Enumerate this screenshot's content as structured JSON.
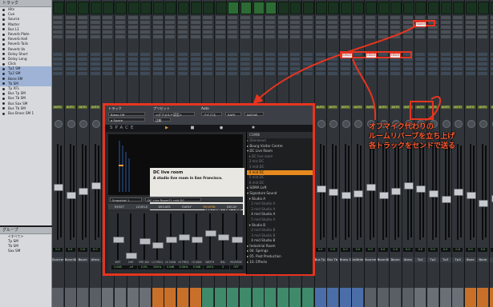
{
  "tracks_panel": {
    "title": "トラック",
    "items": [
      {
        "label": "Hits"
      },
      {
        "label": "Cue"
      },
      {
        "label": "Source"
      },
      {
        "label": "Master"
      },
      {
        "label": "Bus L1"
      },
      {
        "label": "Reverb Plate"
      },
      {
        "label": "Reverb Hall"
      },
      {
        "label": "Reverb Tails"
      },
      {
        "label": "Reverb Vo"
      },
      {
        "label": "Delay Short"
      },
      {
        "label": "Delay Long"
      },
      {
        "label": "Click"
      },
      {
        "label": "Tp1 SM",
        "selected": true
      },
      {
        "label": "Tp2 SM",
        "selected": true
      },
      {
        "label": "Bone SM",
        "selected": true
      },
      {
        "label": "Tb SM",
        "selected": true
      },
      {
        "label": "Tp XFL"
      },
      {
        "label": "Bus Tp SM"
      },
      {
        "label": "Bus Tb SM"
      },
      {
        "label": "Bus Sax SM"
      },
      {
        "label": "Bus Tb SM"
      },
      {
        "label": "Bus Brass SM 1"
      }
    ]
  },
  "groups_panel": {
    "title": "グループ",
    "items": [
      {
        "label": "<すべて>"
      },
      {
        "label": "Tp SM"
      },
      {
        "label": "Tb SM"
      },
      {
        "label": "Sax SM"
      }
    ]
  },
  "strip_labels": [
    "Sources",
    "Bourn$MX",
    "Bourn",
    "Atmo",
    "Tp1",
    "Tp2",
    "Tp3",
    "Tp4",
    "Bone",
    "Bone",
    "Tb",
    "Tb",
    "Sax",
    "Sax",
    "Sax",
    "Sax",
    "Sax",
    "Sax",
    "Sax",
    "Sax",
    "Sax",
    "Bus Tp SM",
    "Bus Tb SM",
    "Brass Off",
    "AnBrdmL1"
  ],
  "strip_inserts": [
    "Space",
    "Space",
    "Space",
    "BCAB.LEAT",
    "Half Fury D",
    "H Ceeks",
    "Snooker",
    "SXPRTCX",
    "1000",
    "Space",
    "Space",
    "MiniLoud",
    "Slate",
    "Slate",
    "Slate"
  ],
  "space_send": "SPACE",
  "plugin": {
    "header": {
      "track_label": "トラック",
      "preset_label": "プリセット",
      "auto_label": "Auto",
      "track_value": "Brass Off",
      "insert_value": "a Space",
      "preset_value": "<デフォルト設定>",
      "compare": "比較",
      "bypass": "バイパス",
      "safe": "SAFE",
      "native": "NATIVE"
    },
    "brand": "SPACE",
    "ir": {
      "title": "DC live room",
      "description": "A studio live room in San Francisco.",
      "logo": "TRILLIUM LANE LABS"
    },
    "browser": {
      "header": "COMBI",
      "items": [
        {
          "label": "▸ Sherwood",
          "dim": true
        },
        {
          "label": "▸ Bourg Visitor Centre"
        },
        {
          "label": "▾ DC Live Room"
        },
        {
          "label": "  ▾ DC live room",
          "dim": true
        },
        {
          "label": "  2 mic DC",
          "dim": true
        },
        {
          "label": "  3 mid DC",
          "dim": true
        },
        {
          "label": "  4 mid DC",
          "selected": true
        },
        {
          "label": "  5 mid DC",
          "dim": true
        },
        {
          "label": "  6 mid DC",
          "dim": true
        },
        {
          "label": "▸ SOMA Loft"
        },
        {
          "label": "▾ Signature Sound"
        },
        {
          "label": "  ▾ Studio A"
        },
        {
          "label": "    2 mid Studio A",
          "dim": true
        },
        {
          "label": "    3 mid Studio A",
          "dim": true
        },
        {
          "label": "    4 mid Studio A"
        },
        {
          "label": "    5 mid Studio A",
          "dim": true
        },
        {
          "label": "  ▾ Studio B"
        },
        {
          "label": "    2 mid Studio B",
          "dim": true
        },
        {
          "label": "    3 mid Studio B",
          "dim": true
        },
        {
          "label": "    4 mid Studio B"
        },
        {
          "label": "▸ Industrial Room"
        },
        {
          "label": "▸ 04. Springs"
        },
        {
          "label": "▸ 05. Post Production"
        },
        {
          "label": "▸ 10. Effects"
        }
      ]
    },
    "preset_bar": {
      "snapshot": "Snapshot 1",
      "preset": "DC Live Room?1 mid DC"
    },
    "param_tabs": [
      {
        "label": "RESET"
      },
      {
        "label": "LEVELS"
      },
      {
        "label": "DECAYS",
        "active": false
      },
      {
        "label": "EARLY"
      },
      {
        "label": "REVERB",
        "active": true
      },
      {
        "label": "DECAY"
      }
    ],
    "faders": [
      {
        "label": "WET",
        "value": "0.0dB",
        "pos": 0.55
      },
      {
        "label": "DRY",
        "value": "-inf",
        "pos": 0.95
      },
      {
        "label": "PRE-DLY",
        "value": "0.0%",
        "pos": 0.6
      },
      {
        "label": "LO FREQ",
        "value": "250Hz",
        "pos": 0.7
      },
      {
        "label": "LO GAIN",
        "value": "0.0dB",
        "pos": 0.55
      },
      {
        "label": "HI FREQ",
        "value": "5.0kHz",
        "pos": 0.5
      },
      {
        "label": "HI GAIN",
        "value": "0.0dB",
        "pos": 0.55
      },
      {
        "label": "WIDTH",
        "value": "100%",
        "pos": 0.4
      },
      {
        "label": "BAL",
        "value": "0",
        "pos": 0.5
      },
      {
        "label": "REVERSE",
        "value": "OFF",
        "pos": 0.55
      }
    ]
  },
  "callout": {
    "lines": [
      "オフマイク代わりの",
      "ルームリバーブを立ち上げ",
      "各トラックをセンドで送る"
    ]
  },
  "colors": {
    "accent": "#e8341f",
    "callout": "#ff5a2e",
    "selected": "#e78a1e"
  }
}
